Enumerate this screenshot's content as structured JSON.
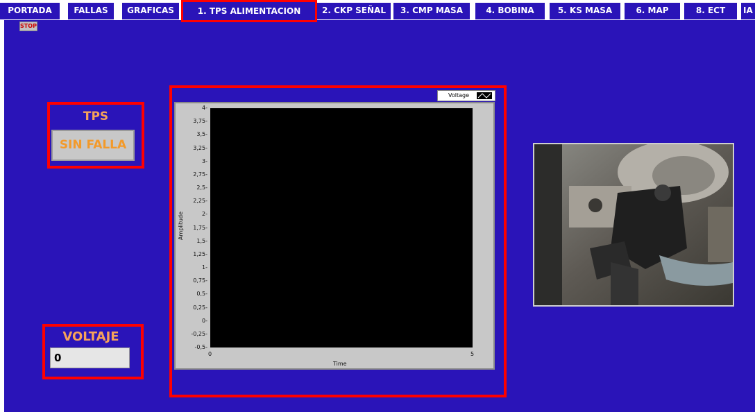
{
  "tabs": [
    {
      "label": "PORTADA",
      "active": false
    },
    {
      "label": "FALLAS",
      "active": false
    },
    {
      "label": "GRAFICAS",
      "active": false
    },
    {
      "label": "1. TPS ALIMENTACION",
      "active": true
    },
    {
      "label": "2. CKP SEÑAL",
      "active": false
    },
    {
      "label": "3. CMP MASA",
      "active": false
    },
    {
      "label": "4. BOBINA",
      "active": false
    },
    {
      "label": "5. KS MASA",
      "active": false
    },
    {
      "label": "6. MAP",
      "active": false
    },
    {
      "label": "8. ECT",
      "active": false
    },
    {
      "label": "IA",
      "active": false
    }
  ],
  "stop_button": {
    "label": "STOP"
  },
  "tps": {
    "title": "TPS",
    "status": "SIN FALLA"
  },
  "voltaje": {
    "title": "VOLTAJE",
    "value": "0"
  },
  "chart_data": {
    "type": "line",
    "title": "",
    "xlabel": "Time",
    "ylabel": "Amplitude",
    "xlim": [
      0,
      5
    ],
    "ylim": [
      -0.5,
      4
    ],
    "x_ticks": [
      "0",
      "5"
    ],
    "y_ticks": [
      "4",
      "3,75",
      "3,5",
      "3,25",
      "3",
      "2,75",
      "2,5",
      "2,25",
      "2",
      "1,75",
      "1,5",
      "1,25",
      "1",
      "0,75",
      "0,5",
      "0,25",
      "0",
      "-0,25",
      "-0,5"
    ],
    "series": [
      {
        "name": "Voltage",
        "values": []
      }
    ],
    "legend": "top-right",
    "plot_background": "#000000"
  },
  "colors": {
    "panel": "#2a14b8",
    "highlight": "#ff0000",
    "label": "#f6a25a"
  },
  "photo": {
    "icon": "throttle-position-sensor-photo"
  }
}
